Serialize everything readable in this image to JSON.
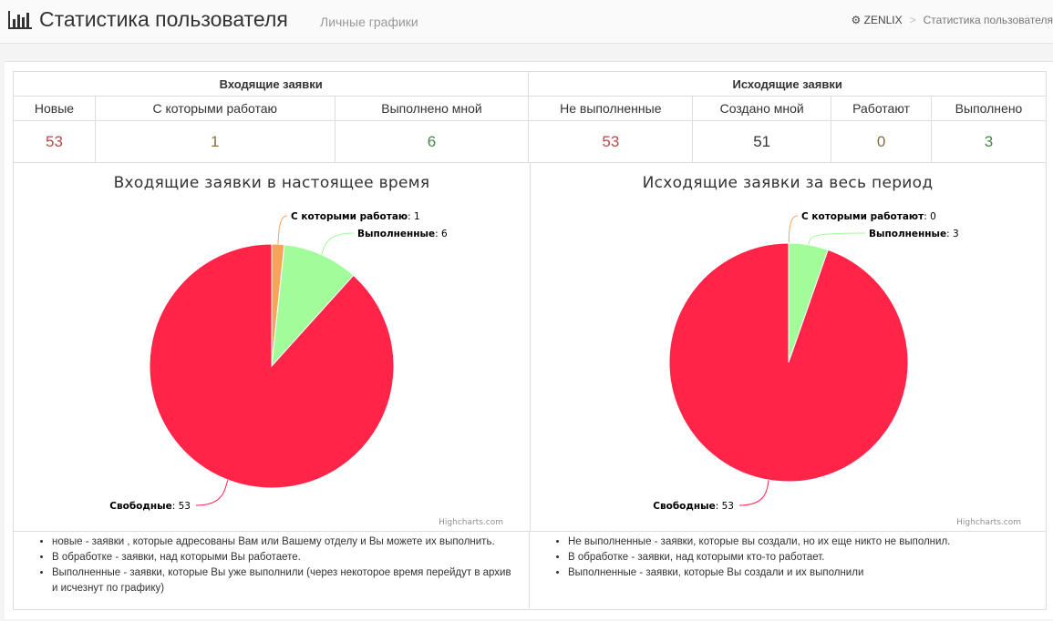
{
  "header": {
    "title": "Статистика пользователя",
    "subtitle": "Личные графики",
    "icon": "bar-chart-icon",
    "breadcrumb": {
      "home_icon": "gear-icon",
      "home": "ZENLIX",
      "separator": ">",
      "current": "Статистика пользователя"
    }
  },
  "stats": {
    "incoming_title": "Входящие заявки",
    "outgoing_title": "Исходящие заявки",
    "columns": [
      {
        "label": "Новые",
        "value": "53",
        "color": "#b94a48"
      },
      {
        "label": "С которыми работаю",
        "value": "1",
        "color": "#8a6d3b"
      },
      {
        "label": "Выполнено мной",
        "value": "6",
        "color": "#468847"
      },
      {
        "label": "Не выполненные",
        "value": "53",
        "color": "#b94a48"
      },
      {
        "label": "Создано мной",
        "value": "51",
        "color": "#333333"
      },
      {
        "label": "Работают",
        "value": "0",
        "color": "#8a6d3b"
      },
      {
        "label": "Выполнено",
        "value": "3",
        "color": "#468847"
      }
    ]
  },
  "chart_data": [
    {
      "type": "pie",
      "title": "Входящие заявки в настоящее время",
      "credit": "Highcharts.com",
      "slices": [
        {
          "name": "С которыми работаю",
          "value": 1,
          "color": "#f7a35c"
        },
        {
          "name": "Выполненные",
          "value": 6,
          "color": "#a3fc9a"
        },
        {
          "name": "Свободные",
          "value": 53,
          "color": "#ff2448"
        }
      ]
    },
    {
      "type": "pie",
      "title": "Исходящие заявки за весь период",
      "credit": "Highcharts.com",
      "slices": [
        {
          "name": "С которыми работают",
          "value": 0,
          "color": "#f7a35c"
        },
        {
          "name": "Выполненные",
          "value": 3,
          "color": "#a3fc9a"
        },
        {
          "name": "Свободные",
          "value": 53,
          "color": "#ff2448"
        }
      ]
    }
  ],
  "notes": {
    "left": [
      "новые - заявки , которые адресованы Вам или Вашему отделу и Вы можете их выполнить.",
      "В обработке - заявки, над которыми Вы работаете.",
      "Выполненные - заявки, которые Вы уже выполнили (через некоторое время перейдут в архив и исчезнут по графику)"
    ],
    "right": [
      "Не выполненные - заявки, которые вы создали, но их еще никто не выполнил.",
      "В обработке - заявки, над которыми кто-то работает.",
      "Выполненные - заявки, которые Вы создали и их выполнили"
    ]
  }
}
